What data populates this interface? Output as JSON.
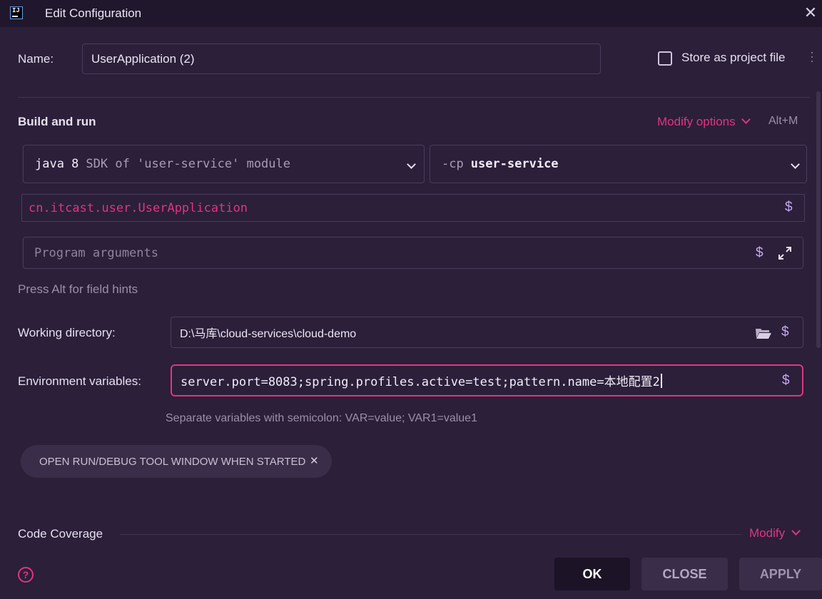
{
  "window": {
    "title": "Edit Configuration"
  },
  "name_row": {
    "label": "Name:",
    "value": "UserApplication (2)",
    "store_label": "Store as project file",
    "store_checked": false
  },
  "build": {
    "header": "Build and run",
    "modify_options": "Modify options",
    "shortcut": "Alt+M",
    "jre_version": "java 8",
    "jre_desc": "SDK of 'user-service' module",
    "cp_flag": "-cp",
    "cp_value": "user-service",
    "main_class": "cn.itcast.user.UserApplication",
    "program_args_placeholder": "Program arguments",
    "hint": "Press Alt for field hints"
  },
  "working_dir": {
    "label": "Working directory:",
    "value": "D:\\马库\\cloud-services\\cloud-demo"
  },
  "env": {
    "label": "Environment variables:",
    "value": "server.port=8083;spring.profiles.active=test;pattern.name=本地配置2",
    "hint": "Separate variables with semicolon: VAR=value; VAR1=value1"
  },
  "chip": {
    "label": "OPEN RUN/DEBUG TOOL WINDOW WHEN STARTED"
  },
  "coverage": {
    "label": "Code Coverage",
    "modify": "Modify"
  },
  "footer": {
    "ok": "OK",
    "close": "CLOSE",
    "apply": "APPLY",
    "help_icon": "?"
  },
  "colors": {
    "accent": "#e0357f",
    "background": "#2b1f3a",
    "titlebar": "#21172d",
    "dollar": "#c7a6f0"
  },
  "icons": [
    "jetbrains-logo-icon",
    "close-icon",
    "kebab-icon",
    "chevron-down-icon",
    "dollar-icon",
    "expand-icon",
    "folder-icon",
    "help-icon"
  ]
}
